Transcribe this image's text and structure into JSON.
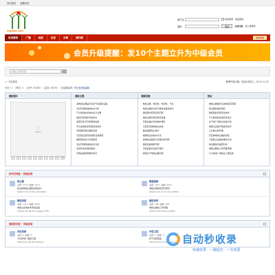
{
  "topbar": {
    "home": "设为首页",
    "fav": "收藏本站"
  },
  "logo": {
    "text": "eppbbs.com"
  },
  "login": {
    "user_label": "用户名",
    "auto_login": "自动登录",
    "forgot": "找回密码",
    "pwd_label": "密码",
    "login_btn": "登录",
    "register": "立即注册",
    "register_link": "加入易特网"
  },
  "nav": {
    "items": [
      "论坛首页",
      "广播",
      "动态",
      "日志",
      "分享",
      "排行榜"
    ],
    "quick": "快捷导航"
  },
  "banner": {
    "text": "会员升级提醒：发10个主题立升为中级会员"
  },
  "search": {
    "placeholder": "请输入搜索内容"
  },
  "breadcrumb": {
    "home": "论坛首页",
    "notice": "敏博环保仪器、欢迎大家加入（2012-6-20）"
  },
  "stats": {
    "today_label": "今日:",
    "today": "0",
    "yesterday_label": "昨日:",
    "yesterday": "0",
    "posts_label": "帖子:",
    "posts": "61983",
    "members_label": "会员:",
    "members": "49430",
    "newest_label": "欢迎新会员:",
    "newest": "专业电池保温膜"
  },
  "portal": {
    "col1": {
      "title": "最新图片",
      "pic_label": "100%",
      "pages": [
        "1",
        "2",
        "3",
        "4",
        "5",
        "6",
        "7",
        "8",
        "9",
        "10"
      ]
    },
    "col2": {
      "title": "最新主题",
      "items": [
        "静电除尘器是针对空气杀菌的设备",
        "浅谈环保机械的技术分析",
        "气力输送的系统中设计主要",
        "数控风机保护系统优化",
        "新型风机与高效降噪设备",
        "风力发电机的安装调试技术",
        "喷射器式除尘器的应用",
        "高压除尘配件的使用注意事项",
        "脱硫塔的设计注意事项",
        "浅谈环保机械的技术分析",
        "复杂形态系统的组成",
        "环保设备使用维护技巧"
      ]
    },
    "col3": {
      "title": "最新回复",
      "items": [
        "电除尘器、电流低、电压低、气总",
        "电除尘器的分析与维修设备操作问",
        "脱硫塔的安装调试问题",
        "电除尘器高电压整流设备",
        "环保设备的日常维护保养",
        "大型高压静电除尘系统",
        "烟尘脱硫除尘技术",
        "脱硫除尘的技术方法",
        "静电除尘器运行过程中的问题",
        "脱硫设备维修问题",
        "环保设备日常运行保养",
        "求助关于电除尘器问题"
      ]
    },
    "col4": {
      "title": "热帖",
      "items": [
        "电除尘器振打系统的配置原理",
        "除尘器的维护保养",
        "脱硫塔的安装调试技术",
        "气力输送的系统应用设计",
        "关于电厂电除尘改造方案",
        "电除尘设备节能提高技术",
        "工业除尘的管理",
        "高压静电除尘器的安装",
        "大型除尘设备的维护方法",
        "除尘器常见故障分析",
        "电除尘器的工作原理详解",
        "大力发电厂电除尘工程改造"
      ]
    }
  },
  "section1": {
    "title": "技术交流区 - 初级区域",
    "forums": [
      {
        "name": "除尘器",
        "meta": "主题: 2773, 帖数: 9117",
        "last": "除尘器电除尘器的应用设计",
        "last_time": "2024-5-23 13:58 yufan2002"
      },
      {
        "name": "脱硫脱硝",
        "meta": "主题: 2071, 帖数: 6311",
        "last": "电除尘脱硫应用与研究",
        "last_time": "2024-6-24 17:04 zhuoz0830"
      },
      {
        "name": "输送系统",
        "meta": "主题: 1411, 帖数: 4853",
        "last": "电除尘系统技术安装设备",
        "last_time": "2024-6-26 18:23 yanggum789"
      },
      {
        "name": "输送系统",
        "meta": "主题: 266, 帖数: 989",
        "last": "电除尘器的工作原理",
        "last_time": "2024-5-25 09:36 pu5000"
      }
    ]
  },
  "section2": {
    "title": "通用技术区 - 中级区域",
    "forums": [
      {
        "name": "风机泵阀",
        "meta": "主题: 5, 帖数: 5",
        "last": "大功率电厂脱硫工程",
        "last_time": "2023-10-1 20:20 tofahng"
      },
      {
        "name": "环保工程",
        "meta": "主题: 1, 帖数: 1",
        "last": "喷干自塔回答",
        "last_time": "2023-12-24 11:46 xiyuhuu"
      }
    ]
  },
  "watermark": {
    "brand": "自动秒收录",
    "slogan": "快速收录 · 一键提交 · 一次收录"
  }
}
